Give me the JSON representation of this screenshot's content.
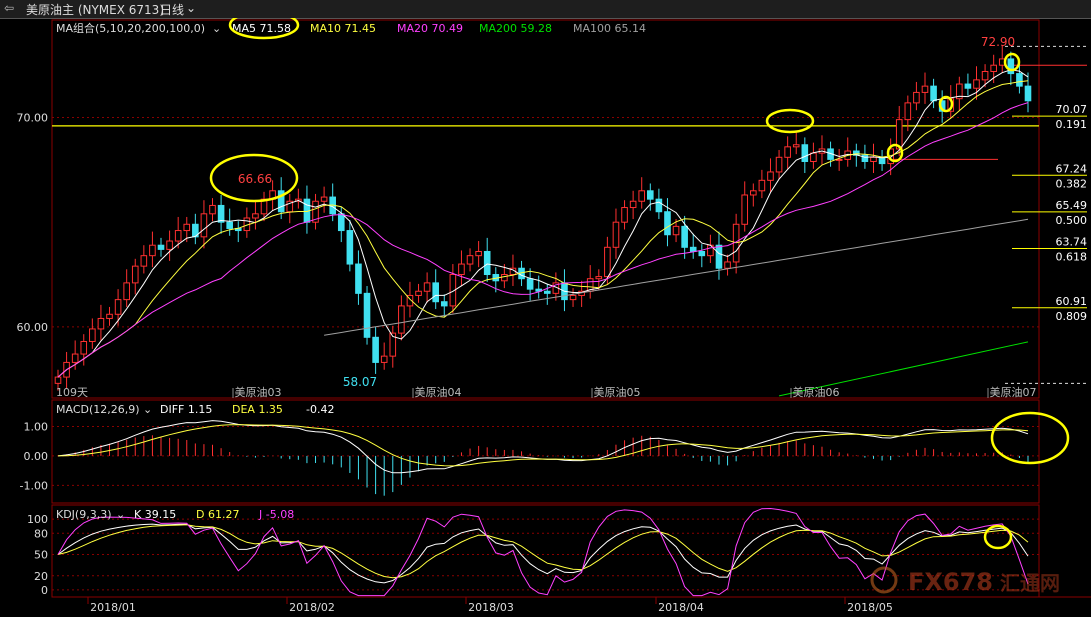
{
  "window": {
    "back_icon": "back-arrow-icon",
    "title": "美原油主 (NYMEX 6713)",
    "period": "日线",
    "dropdown_icon": "chevron-down-icon"
  },
  "colors": {
    "up": "#ff3030",
    "down": "#40e0f0",
    "ma5": "#ffffff",
    "ma10": "#ffff40",
    "ma20": "#ff40ff",
    "ma200": "#00e000",
    "ma100": "#a0a0a0",
    "diff": "#ffffff",
    "dea": "#ffff40",
    "k": "#ffffff",
    "d": "#ffff40",
    "j": "#ff40ff",
    "fib": "#ffff00",
    "grid": "#8a0000"
  },
  "chart_data": [
    {
      "type": "candlestick",
      "indicator_label": "MA组合(5,10,20,200,100,0)",
      "legend": [
        {
          "name": "MA5",
          "value": "71.58"
        },
        {
          "name": "MA10",
          "value": "71.45"
        },
        {
          "name": "MA20",
          "value": "70.49"
        },
        {
          "name": "MA200",
          "value": "59.28"
        },
        {
          "name": "MA100",
          "value": "65.14"
        }
      ],
      "ylim": [
        56.6,
        73.8
      ],
      "yticks": [
        "70.00",
        "60.00"
      ],
      "month_markers": [
        "美原油03",
        "美原油04",
        "美原油05",
        "美原油06",
        "美原油07"
      ],
      "corner_label": "109天",
      "annotations": [
        {
          "text": "66.66",
          "value": 66.66
        },
        {
          "text": "58.07",
          "value": 58.07
        },
        {
          "text": "72.90",
          "value": 72.9
        }
      ],
      "fib_levels": [
        {
          "price": "70.07",
          "ratio": "0.191"
        },
        {
          "price": "67.24",
          "ratio": "0.382"
        },
        {
          "price": "65.49",
          "ratio": "0.500"
        },
        {
          "price": "63.74",
          "ratio": "0.618"
        },
        {
          "price": "60.91",
          "ratio": "0.809"
        }
      ],
      "yellow_support_line": 69.6,
      "closes": [
        57.6,
        58.3,
        58.7,
        59.3,
        59.9,
        60.4,
        60.6,
        61.3,
        62.1,
        62.9,
        63.4,
        63.9,
        63.7,
        64.1,
        64.6,
        64.9,
        64.3,
        65.4,
        65.8,
        65.0,
        64.7,
        64.6,
        65.2,
        65.4,
        66.1,
        66.5,
        65.5,
        66.0,
        66.1,
        65.0,
        66.0,
        66.2,
        65.4,
        64.6,
        63.0,
        61.6,
        59.5,
        58.3,
        58.6,
        59.7,
        61.0,
        61.5,
        61.7,
        62.1,
        61.2,
        61.0,
        62.5,
        63.0,
        63.4,
        63.6,
        62.5,
        62.2,
        62.5,
        62.8,
        62.3,
        61.8,
        61.7,
        61.6,
        62.1,
        61.3,
        61.5,
        61.7,
        62.3,
        62.4,
        63.8,
        65.0,
        65.7,
        66.0,
        66.5,
        66.1,
        65.5,
        64.4,
        64.8,
        63.8,
        63.6,
        63.4,
        63.9,
        62.8,
        63.1,
        64.9,
        66.3,
        66.5,
        67.0,
        67.4,
        68.1,
        68.6,
        68.7,
        67.9,
        68.3,
        68.5,
        68.0,
        68.0,
        68.4,
        68.2,
        67.9,
        68.1,
        67.8,
        68.5,
        69.9,
        70.7,
        71.2,
        71.5,
        70.8,
        70.3,
        70.9,
        71.6,
        71.4,
        71.8,
        72.2,
        72.5,
        72.8,
        72.1,
        71.5,
        70.8
      ],
      "ma5_last": 71.58,
      "ma10_last": 71.45,
      "ma20_last": 70.49,
      "ma100_last": 65.14,
      "ma200_last": 59.28
    },
    {
      "type": "bar+line",
      "indicator_label": "MACD(12,26,9)",
      "legend": [
        {
          "name": "DIFF",
          "value": "1.15"
        },
        {
          "name": "DEA",
          "value": "1.35"
        },
        {
          "name": "",
          "value": "-0.42"
        }
      ],
      "ylim": [
        -1.6,
        1.9
      ],
      "yticks": [
        "1.00",
        "0.00",
        "-1.00"
      ]
    },
    {
      "type": "line",
      "indicator_label": "KDJ(9,3,3)",
      "legend": [
        {
          "name": "K",
          "value": "39.15"
        },
        {
          "name": "D",
          "value": "61.27"
        },
        {
          "name": "J",
          "value": "-5.08"
        }
      ],
      "ylim": [
        -10,
        120
      ],
      "yticks": [
        "100",
        "80",
        "50",
        "20",
        "0"
      ]
    }
  ],
  "time_axis": [
    "2018/01",
    "2018/02",
    "2018/03",
    "2018/04",
    "2018/05"
  ],
  "watermark": {
    "text": "FX678",
    "suffix": "汇通网"
  }
}
